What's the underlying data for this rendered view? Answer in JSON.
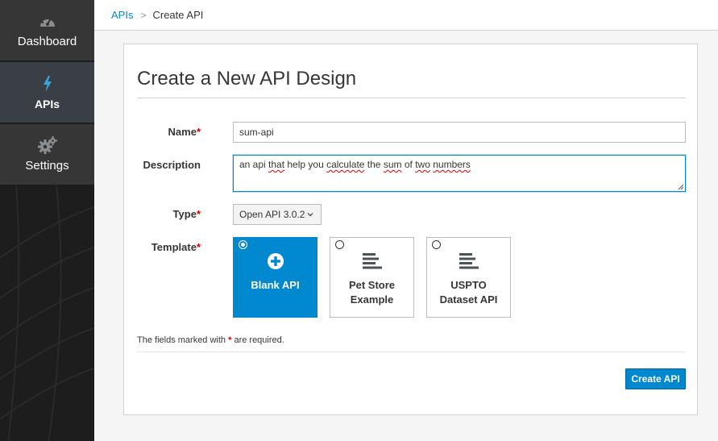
{
  "sidebar": {
    "items": [
      {
        "label": "Dashboard",
        "icon": "dashboard-icon",
        "active": false
      },
      {
        "label": "APIs",
        "icon": "bolt-icon",
        "active": true
      },
      {
        "label": "Settings",
        "icon": "gears-icon",
        "active": false
      }
    ]
  },
  "breadcrumb": {
    "parent": "APIs",
    "separator": ">",
    "current": "Create API"
  },
  "form": {
    "title": "Create a New API Design",
    "name": {
      "label": "Name",
      "required_mark": "*",
      "value": "sum-api"
    },
    "description": {
      "label": "Description",
      "value": "an api that help you calculate the sum of two numbers",
      "parts": [
        "an api ",
        "that",
        " help you ",
        "calculate",
        " the ",
        "sum",
        " of ",
        "two",
        " ",
        "numbers"
      ]
    },
    "type": {
      "label": "Type",
      "required_mark": "*",
      "value": "Open API 3.0.2"
    },
    "template": {
      "label": "Template",
      "required_mark": "*",
      "options": [
        {
          "label": "Blank API",
          "icon": "plus-circle-icon",
          "selected": true
        },
        {
          "label": "Pet Store Example",
          "icon": "list-lines-icon",
          "selected": false
        },
        {
          "label": "USPTO Dataset API",
          "icon": "list-lines-icon",
          "selected": false
        }
      ]
    },
    "note_prefix": "The fields marked with ",
    "note_mark": "*",
    "note_suffix": " are required.",
    "submit_label": "Create API"
  },
  "colors": {
    "accent": "#0088ce",
    "required": "#cc0000",
    "sidebar": "#1d1d1d",
    "sidebar_item": "#363636",
    "sidebar_active": "#393f45"
  }
}
